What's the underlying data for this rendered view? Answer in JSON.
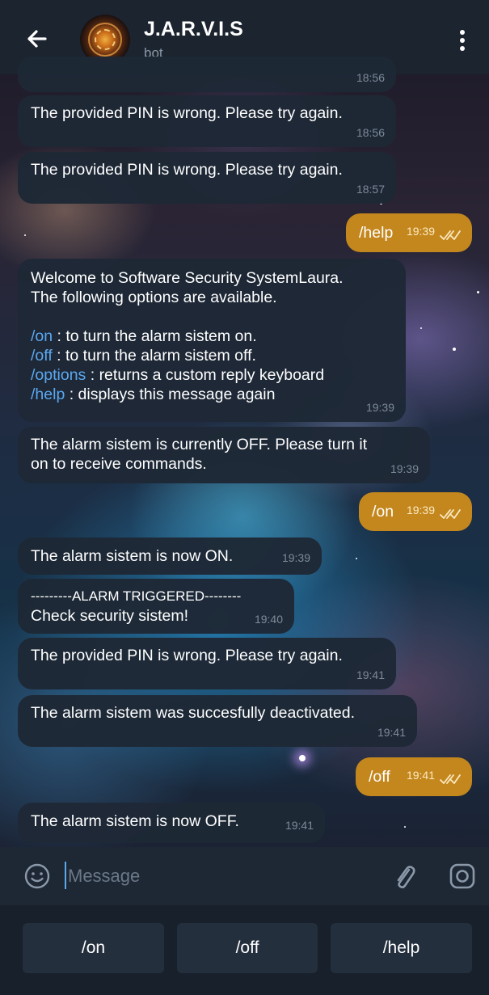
{
  "header": {
    "title": "J.A.R.V.I.S",
    "subtitle": "bot"
  },
  "messages": [
    {
      "text": "",
      "time": "18:56"
    },
    {
      "text": "The provided PIN is wrong. Please try again.",
      "time": "18:56"
    },
    {
      "text": "The provided PIN is wrong. Please try again.",
      "time": "18:57"
    },
    {
      "text": "/help",
      "time": "19:39"
    },
    {
      "lines": [
        "Welcome to Software Security SystemLaura.",
        "The following options are available."
      ],
      "commands": [
        {
          "cmd": "/on",
          "desc": " : to turn the alarm sistem on."
        },
        {
          "cmd": "/off",
          "desc": " : to turn the alarm sistem off."
        },
        {
          "cmd": "/options",
          "desc": " : returns a custom reply keyboard"
        },
        {
          "cmd": "/help",
          "desc": " : displays this message again"
        }
      ],
      "time": "19:39"
    },
    {
      "lines": [
        "The alarm sistem is currently OFF. Please turn it",
        "on to receive commands."
      ],
      "time": "19:39"
    },
    {
      "text": "/on",
      "time": "19:39"
    },
    {
      "text": "The alarm sistem is now ON.",
      "time": "19:39"
    },
    {
      "lines": [
        "---------ALARM TRIGGERED--------",
        "Check security sistem!"
      ],
      "time": "19:40"
    },
    {
      "text": "The provided PIN is wrong. Please try again.",
      "time": "19:41"
    },
    {
      "text": "The alarm sistem was succesfully deactivated.",
      "time": "19:41"
    },
    {
      "text": "/off",
      "time": "19:41"
    },
    {
      "text": "The alarm sistem is now OFF.",
      "time": "19:41"
    }
  ],
  "input": {
    "placeholder": "Message"
  },
  "keyboard": {
    "buttons": [
      "/on",
      "/off",
      "/help"
    ]
  },
  "icons": {
    "back": "arrow-left-icon",
    "menu": "more-vertical-icon",
    "emoji": "emoji-icon",
    "attach": "paperclip-icon",
    "camera": "camera-icon",
    "read": "double-check-icon"
  },
  "colors": {
    "accent": "#5ba8ef",
    "outgoing_bubble": "#c4871d",
    "incoming_bubble": "#1e2836"
  }
}
